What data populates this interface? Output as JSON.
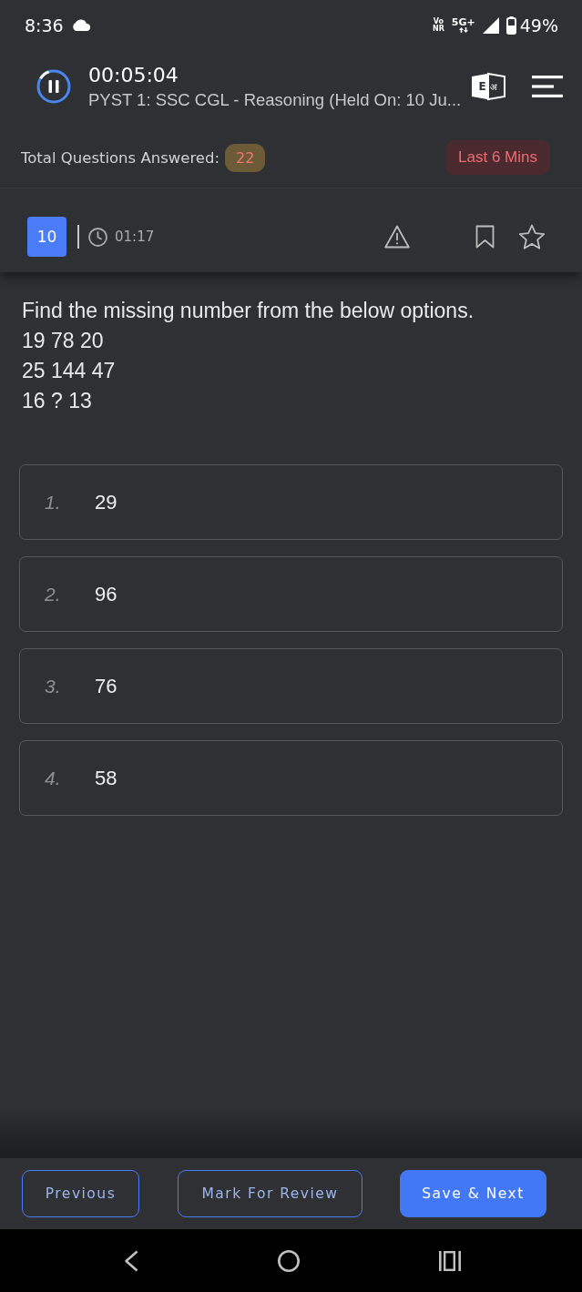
{
  "status_bar": {
    "time": "8:36",
    "voice_label": [
      "Vo",
      "NR"
    ],
    "network": "5G+",
    "battery": "49%"
  },
  "header": {
    "timer": "00:05:04",
    "title": "PYST 1: SSC CGL - Reasoning (Held On: 10 Ju...",
    "language_toggle": [
      "E",
      "अ"
    ]
  },
  "stats": {
    "label": "Total Questions Answered:",
    "answered": "22",
    "time_window": "Last 6 Mins"
  },
  "question_bar": {
    "number": "10",
    "time": "01:17",
    "bookmarked": false,
    "starred": false
  },
  "question": {
    "lines": [
      "Find the missing number from the below options.",
      "19 78 20",
      "25 144 47",
      "16 ? 13"
    ]
  },
  "options": [
    {
      "number": "1.",
      "value": "29",
      "selected": false
    },
    {
      "number": "2.",
      "value": "96",
      "selected": false
    },
    {
      "number": "3.",
      "value": "76",
      "selected": false
    },
    {
      "number": "4.",
      "value": "58",
      "selected": false
    }
  ],
  "buttons": [
    {
      "label": "Previous",
      "kind": "outline"
    },
    {
      "label": "Mark For Review",
      "kind": "outline"
    },
    {
      "label": "Save & Next",
      "kind": "filled"
    }
  ]
}
